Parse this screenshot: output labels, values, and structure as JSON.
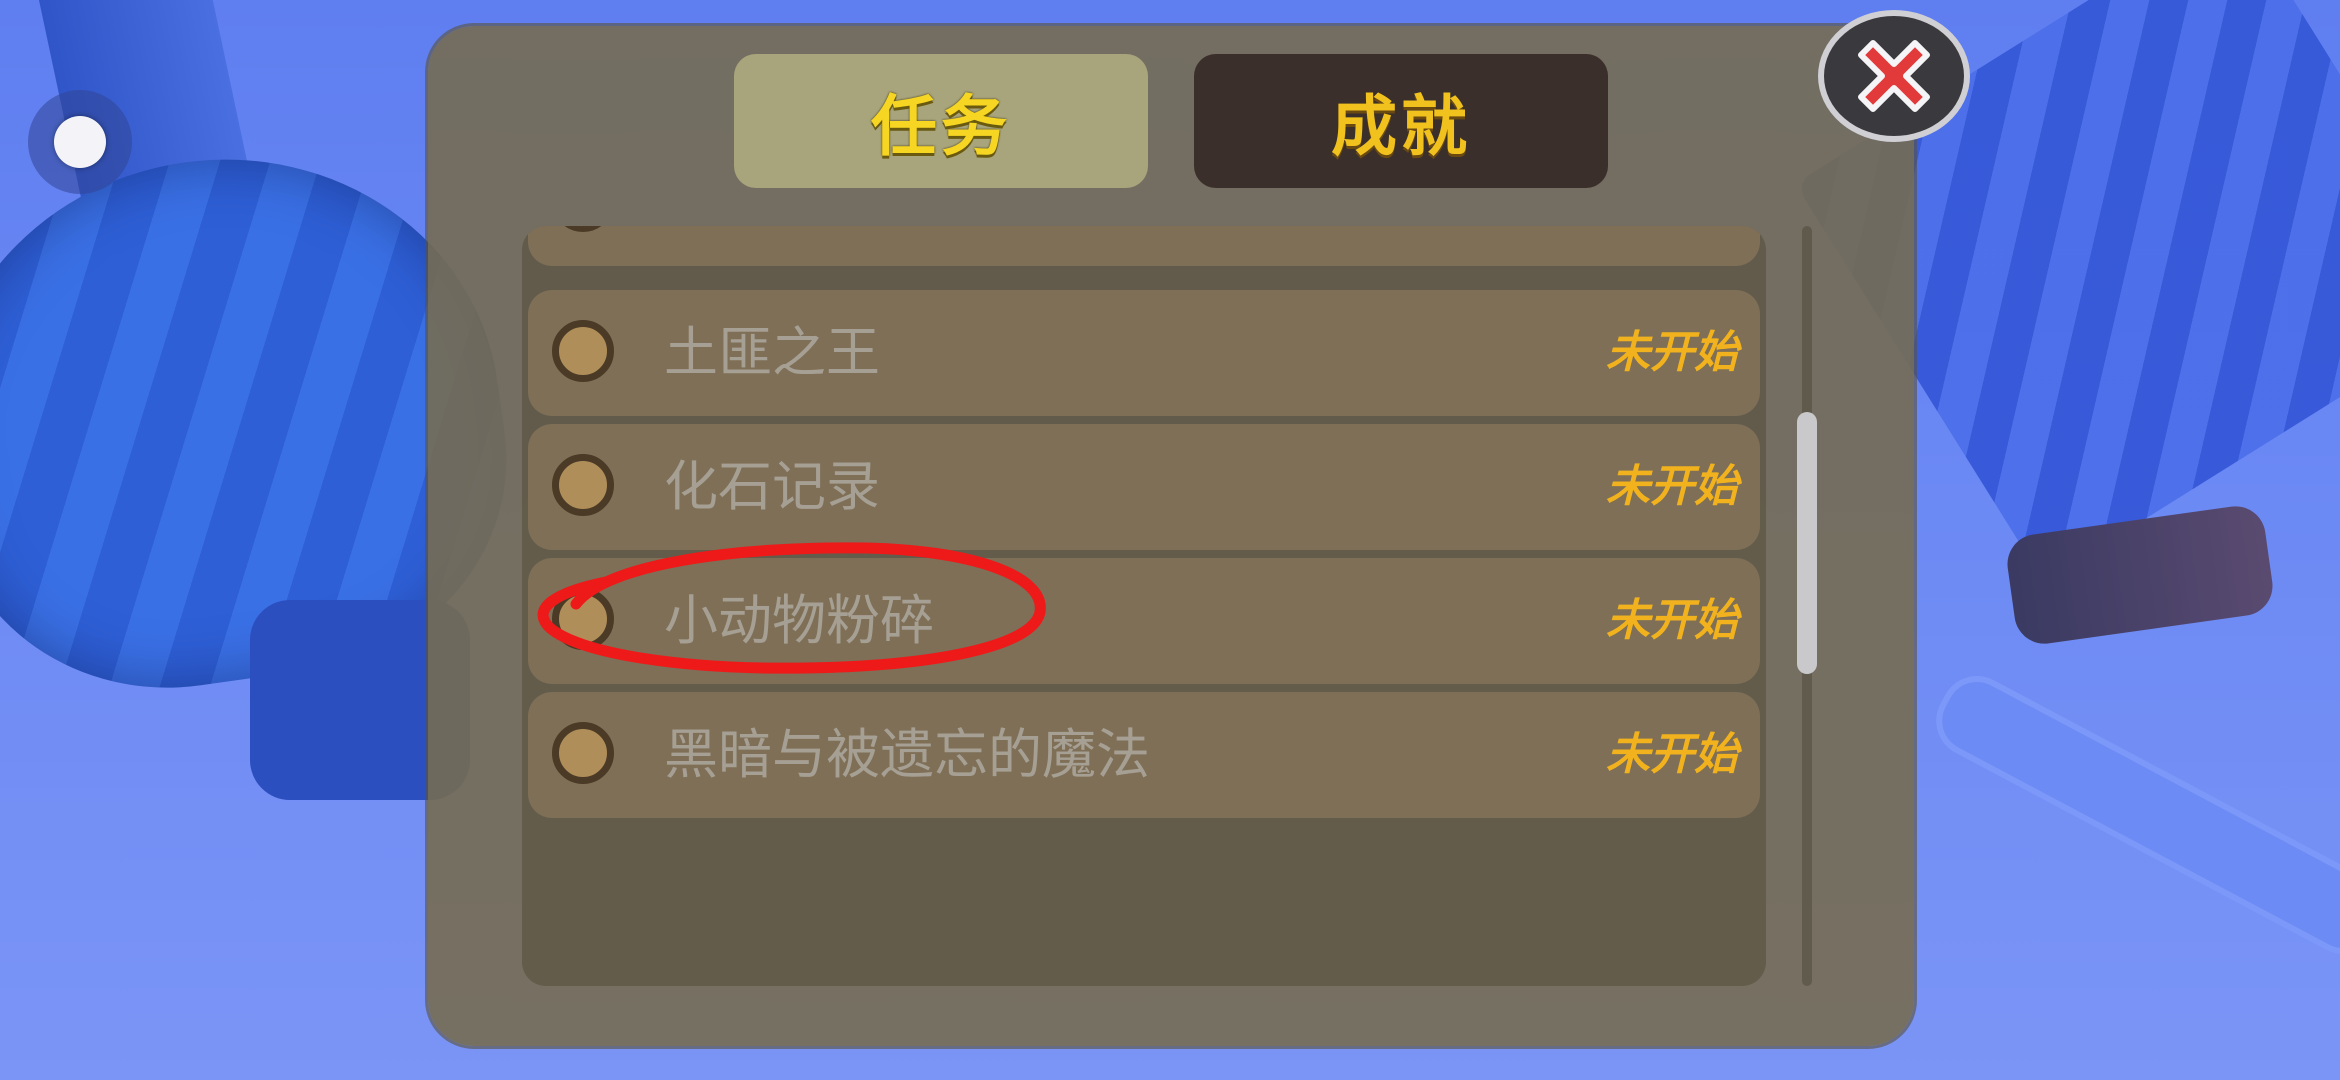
{
  "tabs": [
    {
      "label": "任务",
      "active": true
    },
    {
      "label": "成就",
      "active": false
    }
  ],
  "quests": [
    {
      "title": "土匪之王",
      "status": "未开始"
    },
    {
      "title": "化石记录",
      "status": "未开始"
    },
    {
      "title": "小动物粉碎",
      "status": "未开始"
    },
    {
      "title": "黑暗与被遗忘的魔法",
      "status": "未开始"
    }
  ],
  "close_icon": "close-x-icon",
  "joystick_icon": "joystick-knob-icon",
  "annotation": "red-hand-drawn-ellipse",
  "colors": {
    "tab_text_active": "#f6d622",
    "tab_text_inactive": "#f1c21e",
    "status_text": "#f1b21e",
    "quest_title_text": "#a69f93",
    "close_x": "#e23a3a",
    "annotation": "#ee1a1a"
  }
}
